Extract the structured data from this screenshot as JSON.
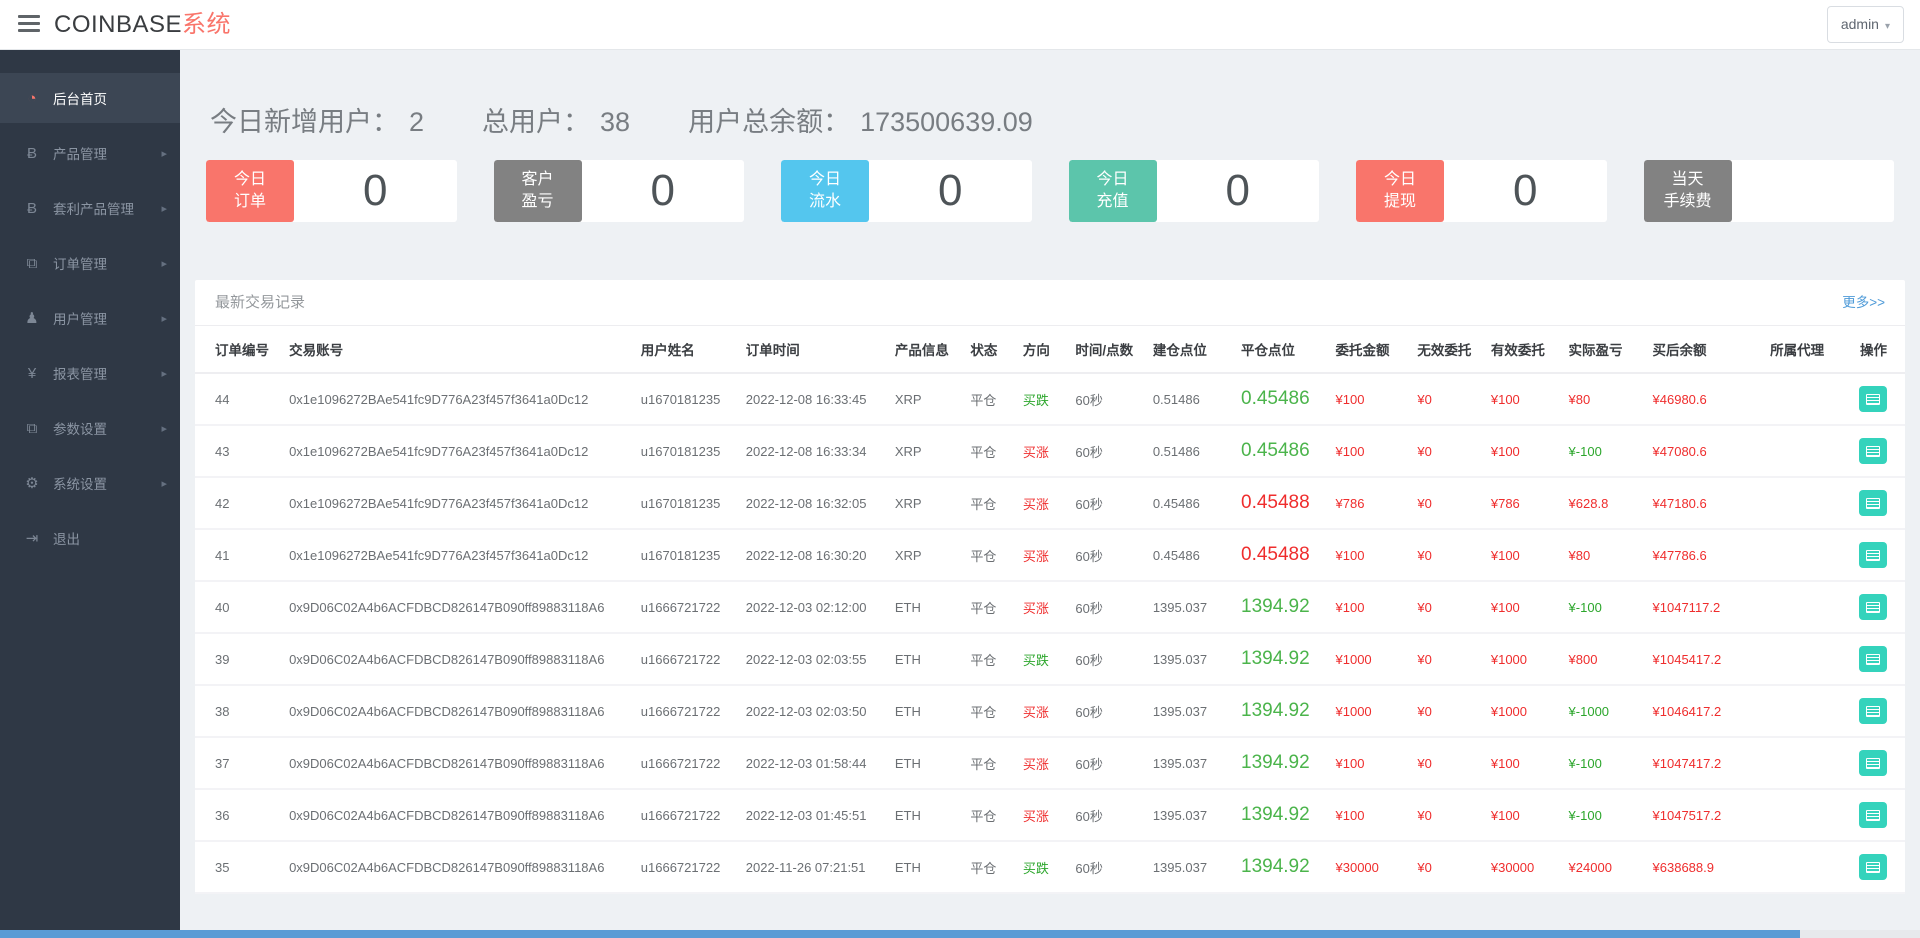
{
  "app": {
    "title_main": "COINBASE",
    "title_accent": "系统",
    "user": "admin"
  },
  "sidebar": {
    "items": [
      {
        "key": "home",
        "label": "后台首页",
        "icon": "dashboard-icon",
        "active": true,
        "arrow": false
      },
      {
        "key": "products",
        "label": "产品管理",
        "icon": "bitcoin-icon",
        "active": false,
        "arrow": true
      },
      {
        "key": "arbitrage",
        "label": "套利产品管理",
        "icon": "bitcoin-icon",
        "active": false,
        "arrow": true
      },
      {
        "key": "orders",
        "label": "订单管理",
        "icon": "orders-icon",
        "active": false,
        "arrow": true
      },
      {
        "key": "users",
        "label": "用户管理",
        "icon": "user-icon",
        "active": false,
        "arrow": true
      },
      {
        "key": "reports",
        "label": "报表管理",
        "icon": "yen-icon",
        "active": false,
        "arrow": true
      },
      {
        "key": "params",
        "label": "参数设置",
        "icon": "params-icon",
        "active": false,
        "arrow": true
      },
      {
        "key": "system",
        "label": "系统设置",
        "icon": "gear-icon",
        "active": false,
        "arrow": true
      },
      {
        "key": "logout",
        "label": "退出",
        "icon": "logout-icon",
        "active": false,
        "arrow": false
      }
    ]
  },
  "stats": {
    "new_users_label": "今日新增用户：",
    "new_users": "2",
    "total_users_label": "总用户：",
    "total_users": "38",
    "balance_label": "用户总余额：",
    "balance": "173500639.09"
  },
  "cards": [
    {
      "lines": [
        "今日",
        "订单"
      ],
      "value": "0",
      "color": "#f9756b"
    },
    {
      "lines": [
        "客户",
        "盈亏"
      ],
      "value": "0",
      "color": "#828282"
    },
    {
      "lines": [
        "今日",
        "流水"
      ],
      "value": "0",
      "color": "#54c6ee"
    },
    {
      "lines": [
        "今日",
        "充值"
      ],
      "value": "0",
      "color": "#5cc5ab"
    },
    {
      "lines": [
        "今日",
        "提现"
      ],
      "value": "0",
      "color": "#f9756b"
    },
    {
      "lines": [
        "当天",
        "手续费"
      ],
      "value": "",
      "color": "#828282"
    }
  ],
  "panel": {
    "title": "最新交易记录",
    "more": "更多>>"
  },
  "table": {
    "headers": [
      "订单编号",
      "交易账号",
      "用户姓名",
      "订单时间",
      "产品信息",
      "状态",
      "方向",
      "时间/点数",
      "建仓点位",
      "平仓点位",
      "委托金额",
      "无效委托",
      "有效委托",
      "实际盈亏",
      "买后余额",
      "所属代理",
      "操作"
    ],
    "rows": [
      {
        "id": "44",
        "account": "0x1e1096272BAe541fc9D776A23f457f3641a0Dc12",
        "name": "u1670181235",
        "time": "2022-12-08 16:33:45",
        "product": "XRP",
        "status": "平仓",
        "dir": "买跌",
        "dir_c": "green",
        "dur": "60秒",
        "open": "0.51486",
        "close": "0.45486",
        "close_c": "green",
        "amt": "¥100",
        "invalid": "¥0",
        "valid": "¥100",
        "profit": "¥80",
        "profit_c": "red",
        "balance": "¥46980.6",
        "agent": ""
      },
      {
        "id": "43",
        "account": "0x1e1096272BAe541fc9D776A23f457f3641a0Dc12",
        "name": "u1670181235",
        "time": "2022-12-08 16:33:34",
        "product": "XRP",
        "status": "平仓",
        "dir": "买涨",
        "dir_c": "red",
        "dur": "60秒",
        "open": "0.51486",
        "close": "0.45486",
        "close_c": "green",
        "amt": "¥100",
        "invalid": "¥0",
        "valid": "¥100",
        "profit": "¥-100",
        "profit_c": "green",
        "balance": "¥47080.6",
        "agent": ""
      },
      {
        "id": "42",
        "account": "0x1e1096272BAe541fc9D776A23f457f3641a0Dc12",
        "name": "u1670181235",
        "time": "2022-12-08 16:32:05",
        "product": "XRP",
        "status": "平仓",
        "dir": "买涨",
        "dir_c": "red",
        "dur": "60秒",
        "open": "0.45486",
        "close": "0.45488",
        "close_c": "red",
        "amt": "¥786",
        "invalid": "¥0",
        "valid": "¥786",
        "profit": "¥628.8",
        "profit_c": "red",
        "balance": "¥47180.6",
        "agent": ""
      },
      {
        "id": "41",
        "account": "0x1e1096272BAe541fc9D776A23f457f3641a0Dc12",
        "name": "u1670181235",
        "time": "2022-12-08 16:30:20",
        "product": "XRP",
        "status": "平仓",
        "dir": "买涨",
        "dir_c": "red",
        "dur": "60秒",
        "open": "0.45486",
        "close": "0.45488",
        "close_c": "red",
        "amt": "¥100",
        "invalid": "¥0",
        "valid": "¥100",
        "profit": "¥80",
        "profit_c": "red",
        "balance": "¥47786.6",
        "agent": ""
      },
      {
        "id": "40",
        "account": "0x9D06C02A4b6ACFDBCD826147B090ff89883118A6",
        "name": "u1666721722",
        "time": "2022-12-03 02:12:00",
        "product": "ETH",
        "status": "平仓",
        "dir": "买涨",
        "dir_c": "red",
        "dur": "60秒",
        "open": "1395.037",
        "close": "1394.92",
        "close_c": "green",
        "amt": "¥100",
        "invalid": "¥0",
        "valid": "¥100",
        "profit": "¥-100",
        "profit_c": "green",
        "balance": "¥1047117.2",
        "agent": ""
      },
      {
        "id": "39",
        "account": "0x9D06C02A4b6ACFDBCD826147B090ff89883118A6",
        "name": "u1666721722",
        "time": "2022-12-03 02:03:55",
        "product": "ETH",
        "status": "平仓",
        "dir": "买跌",
        "dir_c": "green",
        "dur": "60秒",
        "open": "1395.037",
        "close": "1394.92",
        "close_c": "green",
        "amt": "¥1000",
        "invalid": "¥0",
        "valid": "¥1000",
        "profit": "¥800",
        "profit_c": "red",
        "balance": "¥1045417.2",
        "agent": ""
      },
      {
        "id": "38",
        "account": "0x9D06C02A4b6ACFDBCD826147B090ff89883118A6",
        "name": "u1666721722",
        "time": "2022-12-03 02:03:50",
        "product": "ETH",
        "status": "平仓",
        "dir": "买涨",
        "dir_c": "red",
        "dur": "60秒",
        "open": "1395.037",
        "close": "1394.92",
        "close_c": "green",
        "amt": "¥1000",
        "invalid": "¥0",
        "valid": "¥1000",
        "profit": "¥-1000",
        "profit_c": "green",
        "balance": "¥1046417.2",
        "agent": ""
      },
      {
        "id": "37",
        "account": "0x9D06C02A4b6ACFDBCD826147B090ff89883118A6",
        "name": "u1666721722",
        "time": "2022-12-03 01:58:44",
        "product": "ETH",
        "status": "平仓",
        "dir": "买涨",
        "dir_c": "red",
        "dur": "60秒",
        "open": "1395.037",
        "close": "1394.92",
        "close_c": "green",
        "amt": "¥100",
        "invalid": "¥0",
        "valid": "¥100",
        "profit": "¥-100",
        "profit_c": "green",
        "balance": "¥1047417.2",
        "agent": ""
      },
      {
        "id": "36",
        "account": "0x9D06C02A4b6ACFDBCD826147B090ff89883118A6",
        "name": "u1666721722",
        "time": "2022-12-03 01:45:51",
        "product": "ETH",
        "status": "平仓",
        "dir": "买涨",
        "dir_c": "red",
        "dur": "60秒",
        "open": "1395.037",
        "close": "1394.92",
        "close_c": "green",
        "amt": "¥100",
        "invalid": "¥0",
        "valid": "¥100",
        "profit": "¥-100",
        "profit_c": "green",
        "balance": "¥1047517.2",
        "agent": ""
      },
      {
        "id": "35",
        "account": "0x9D06C02A4b6ACFDBCD826147B090ff89883118A6",
        "name": "u1666721722",
        "time": "2022-11-26 07:21:51",
        "product": "ETH",
        "status": "平仓",
        "dir": "买跌",
        "dir_c": "green",
        "dur": "60秒",
        "open": "1395.037",
        "close": "1394.92",
        "close_c": "green",
        "amt": "¥30000",
        "invalid": "¥0",
        "valid": "¥30000",
        "profit": "¥24000",
        "profit_c": "red",
        "balance": "¥638688.9",
        "agent": ""
      }
    ]
  }
}
